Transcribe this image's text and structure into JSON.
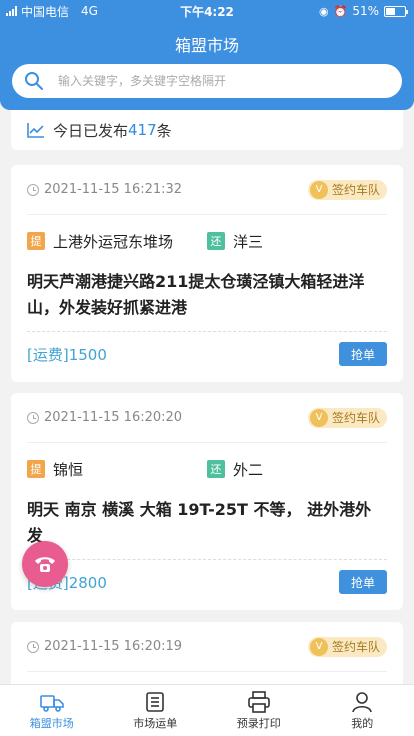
{
  "status_bar": {
    "carrier": "中国电信",
    "network": "4G",
    "time": "下午4:22",
    "battery": "51%",
    "battery_level": 0.51
  },
  "header": {
    "title": "箱盟市场"
  },
  "search": {
    "placeholder": "输入关键字，多关键字空格隔开"
  },
  "today": {
    "prefix": "今日已发布",
    "count": "417",
    "suffix": "条"
  },
  "orders": [
    {
      "time": "2021-11-15 16:21:32",
      "badge": "签约车队",
      "pickup_tag": "提",
      "pickup": "上港外运冠东堆场",
      "return_tag": "还",
      "return": "洋三",
      "desc": "明天芦潮港捷兴路211提太仓璜泾镇大箱轻进洋山，外发装好抓紧进港",
      "fee": "[运费]1500",
      "action": "抢单"
    },
    {
      "time": "2021-11-15 16:20:20",
      "badge": "签约车队",
      "pickup_tag": "提",
      "pickup": "锦恒",
      "return_tag": "还",
      "return": "外二",
      "desc": "明天 南京 横溪 大箱 19T-25T 不等， 进外港外发",
      "fee": "[运费]2800",
      "action": "抢单"
    },
    {
      "time": "2021-11-15 16:20:19",
      "badge": "签约车队"
    }
  ],
  "tabs": [
    {
      "label": "箱盟市场",
      "icon": "truck-icon",
      "active": true
    },
    {
      "label": "市场运单",
      "icon": "list-icon",
      "active": false
    },
    {
      "label": "预录打印",
      "icon": "printer-icon",
      "active": false
    },
    {
      "label": "我的",
      "icon": "user-icon",
      "active": false
    }
  ],
  "colors": {
    "primary": "#3d8fe0",
    "pickup_tag": "#f2a64c",
    "return_tag": "#4fc09e",
    "fee": "#3fa4d3",
    "phone_fab": "#e85c8f"
  }
}
